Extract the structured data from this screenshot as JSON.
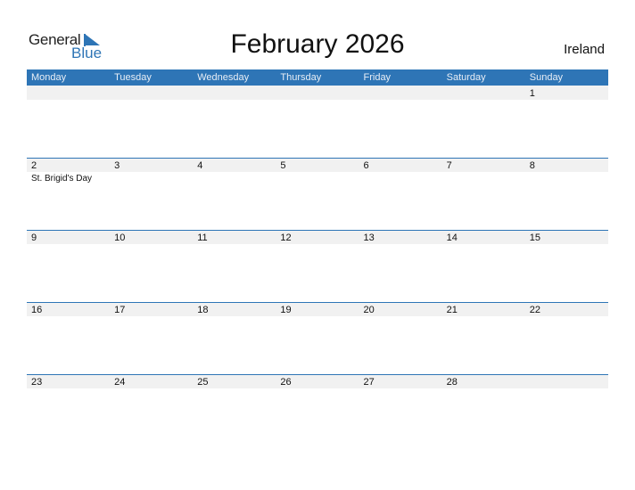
{
  "logo": {
    "word1": "General",
    "word2": "Blue"
  },
  "title": "February 2026",
  "country": "Ireland",
  "colors": {
    "accent": "#2e75b6",
    "date_strip": "#f1f1f1"
  },
  "weekdays": [
    "Monday",
    "Tuesday",
    "Wednesday",
    "Thursday",
    "Friday",
    "Saturday",
    "Sunday"
  ],
  "weeks": [
    {
      "days": [
        {
          "num": "",
          "event": ""
        },
        {
          "num": "",
          "event": ""
        },
        {
          "num": "",
          "event": ""
        },
        {
          "num": "",
          "event": ""
        },
        {
          "num": "",
          "event": ""
        },
        {
          "num": "",
          "event": ""
        },
        {
          "num": "1",
          "event": ""
        }
      ]
    },
    {
      "days": [
        {
          "num": "2",
          "event": "St. Brigid's Day"
        },
        {
          "num": "3",
          "event": ""
        },
        {
          "num": "4",
          "event": ""
        },
        {
          "num": "5",
          "event": ""
        },
        {
          "num": "6",
          "event": ""
        },
        {
          "num": "7",
          "event": ""
        },
        {
          "num": "8",
          "event": ""
        }
      ]
    },
    {
      "days": [
        {
          "num": "9",
          "event": ""
        },
        {
          "num": "10",
          "event": ""
        },
        {
          "num": "11",
          "event": ""
        },
        {
          "num": "12",
          "event": ""
        },
        {
          "num": "13",
          "event": ""
        },
        {
          "num": "14",
          "event": ""
        },
        {
          "num": "15",
          "event": ""
        }
      ]
    },
    {
      "days": [
        {
          "num": "16",
          "event": ""
        },
        {
          "num": "17",
          "event": ""
        },
        {
          "num": "18",
          "event": ""
        },
        {
          "num": "19",
          "event": ""
        },
        {
          "num": "20",
          "event": ""
        },
        {
          "num": "21",
          "event": ""
        },
        {
          "num": "22",
          "event": ""
        }
      ]
    },
    {
      "days": [
        {
          "num": "23",
          "event": ""
        },
        {
          "num": "24",
          "event": ""
        },
        {
          "num": "25",
          "event": ""
        },
        {
          "num": "26",
          "event": ""
        },
        {
          "num": "27",
          "event": ""
        },
        {
          "num": "28",
          "event": ""
        },
        {
          "num": "",
          "event": ""
        }
      ]
    }
  ]
}
